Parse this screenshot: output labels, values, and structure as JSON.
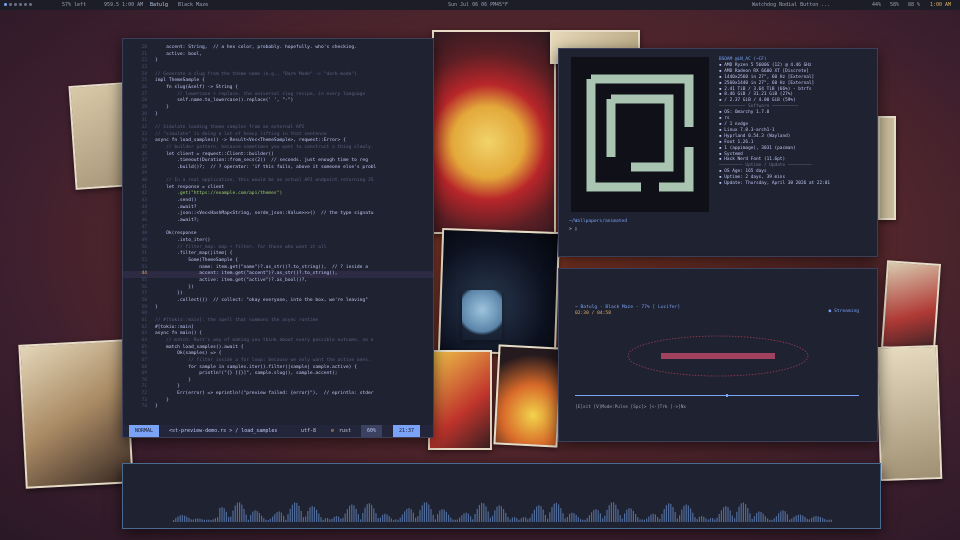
{
  "topbar": {
    "workspaces": "1 2 3 4 5 6",
    "battery": "57% left",
    "mem": "959.5 1:00 AM",
    "workspace_name": "Batulg",
    "track": "Black Maze",
    "datetime": "Sun Jul 06 06 PM",
    "temp": "45°F",
    "right_items": "Watchdog   Nodial Button   ...",
    "volume": "44%",
    "brightness": "58%",
    "battery_right": "88 %",
    "time_right": "1:00 AM"
  },
  "editor": {
    "lines": [
      {
        "n": "20",
        "t": "    accent: String,  // a hex color, probably. hopefully. who's checking.",
        "c": "fn"
      },
      {
        "n": "21",
        "t": "    active: bool,",
        "c": "fn"
      },
      {
        "n": "22",
        "t": "}",
        "c": "fn"
      },
      {
        "n": "23",
        "t": "",
        "c": ""
      },
      {
        "n": "24",
        "t": "// Generate a slug from the theme name (e.g., \"Dark Mode\" -> \"dark-mode\")",
        "c": "cmt"
      },
      {
        "n": "25",
        "t": "impl ThemeSample {",
        "c": "fn"
      },
      {
        "n": "26",
        "t": "    fn slug(&self) -> String {",
        "c": "fn"
      },
      {
        "n": "27",
        "t": "        // lowercase + replace. the universal slug recipe, in every language",
        "c": "cmt"
      },
      {
        "n": "28",
        "t": "        self.name.to_lowercase().replace(' ', \"-\")",
        "c": "fn"
      },
      {
        "n": "29",
        "t": "    }",
        "c": "fn"
      },
      {
        "n": "30",
        "t": "}",
        "c": "fn"
      },
      {
        "n": "31",
        "t": "",
        "c": ""
      },
      {
        "n": "32",
        "t": "// Simulate loading theme samples from an external API",
        "c": "cmt"
      },
      {
        "n": "33",
        "t": "// \"simulate\" is doing a lot of heavy lifting in that sentence",
        "c": "cmt"
      },
      {
        "n": "34",
        "t": "async fn load_samples() -> Result<Vec<ThemeSample>, reqwest::Error> {",
        "c": "fn"
      },
      {
        "n": "35",
        "t": "    // builder pattern, because sometimes you want to construct a thing slowly.",
        "c": "cmt"
      },
      {
        "n": "36",
        "t": "    let client = reqwest::Client::builder()",
        "c": "fn"
      },
      {
        "n": "37",
        "t": "        .timeout(Duration::from_secs(2))  // seconds. just enough time to reg",
        "c": "fn"
      },
      {
        "n": "38",
        "t": "        .build()?;  // ? operator: 'if this fails, above it someone else's probl",
        "c": "fn"
      },
      {
        "n": "39",
        "t": "",
        "c": ""
      },
      {
        "n": "40",
        "t": "    // In a real application, this would be an actual API endpoint returning JS",
        "c": "cmt"
      },
      {
        "n": "41",
        "t": "    let response = client",
        "c": "fn"
      },
      {
        "n": "42",
        "t": "        .get(\"https://example.com/api/themes\")",
        "c": "str"
      },
      {
        "n": "43",
        "t": "        .send()",
        "c": "fn"
      },
      {
        "n": "44",
        "t": "        .await?",
        "c": "fn"
      },
      {
        "n": "45",
        "t": "        .json::<Vec<HashMap<String, serde_json::Value>>>()  // the type signatu",
        "c": "fn"
      },
      {
        "n": "46",
        "t": "        .await?;",
        "c": "fn"
      },
      {
        "n": "47",
        "t": "",
        "c": ""
      },
      {
        "n": "48",
        "t": "    Ok(response",
        "c": "fn"
      },
      {
        "n": "49",
        "t": "        .into_iter()",
        "c": "fn"
      },
      {
        "n": "50",
        "t": "        // filter_map: map + filter, for those who want it all",
        "c": "cmt"
      },
      {
        "n": "51",
        "t": "        .filter_map(|item| {",
        "c": "fn"
      },
      {
        "n": "52",
        "t": "            Some(ThemeSample {",
        "c": "fn"
      },
      {
        "n": "53",
        "t": "                name: item.get(\"name\")?.as_str()?.to_string(),  // ? inside a",
        "c": "fn"
      },
      {
        "n": "44",
        "t": "                accent: item.get(\"accent\")?.as_str()?.to_string(),",
        "c": "fn",
        "cur": true
      },
      {
        "n": "55",
        "t": "                active: item.get(\"active\")?.as_bool()?,",
        "c": "fn"
      },
      {
        "n": "56",
        "t": "            })",
        "c": "fn"
      },
      {
        "n": "57",
        "t": "        })",
        "c": "fn"
      },
      {
        "n": "58",
        "t": "        .collect())  // collect: \"okay everyone, into the box, we're leaving\"",
        "c": "fn"
      },
      {
        "n": "59",
        "t": "}",
        "c": "fn"
      },
      {
        "n": "60",
        "t": "",
        "c": ""
      },
      {
        "n": "61",
        "t": "// #[tokio::main]: the spell that summons the async runtime",
        "c": "cmt"
      },
      {
        "n": "62",
        "t": "#[tokio::main]",
        "c": "fn"
      },
      {
        "n": "63",
        "t": "async fn main() {",
        "c": "fn"
      },
      {
        "n": "64",
        "t": "    // match: Rust's way of making you think about every possible outcome, no e",
        "c": "cmt"
      },
      {
        "n": "65",
        "t": "    match load_samples().await {",
        "c": "fn"
      },
      {
        "n": "66",
        "t": "        Ok(samples) => {",
        "c": "fn"
      },
      {
        "n": "67",
        "t": "            // filter inside a for loop: because we only want the active ones.",
        "c": "cmt"
      },
      {
        "n": "68",
        "t": "            for sample in samples.iter().filter(|sample| sample.active) {",
        "c": "fn"
      },
      {
        "n": "69",
        "t": "                println!(\"{} [{}]\", sample.slug(), sample.accent);",
        "c": "fn"
      },
      {
        "n": "70",
        "t": "            }",
        "c": "fn"
      },
      {
        "n": "71",
        "t": "        }",
        "c": "fn"
      },
      {
        "n": "72",
        "t": "        Err(error) => eprintln!(\"preview failed: {error}\"),  // eprintln: stder",
        "c": "fn"
      },
      {
        "n": "73",
        "t": "    }",
        "c": "fn"
      },
      {
        "n": "74",
        "t": "}",
        "c": "fn"
      }
    ],
    "status": {
      "mode": "NORMAL",
      "file": "<st-preview-demo.rs > / load_samples",
      "encoding": "utf-8",
      "lang": "rust",
      "percent": "60%",
      "position": "21:37"
    }
  },
  "fetch": {
    "user": "BSOAM @LN_AC (~CF)",
    "rows": [
      "AMD Ryzen 5 5600G (12) @ 4.46 GHz",
      "AMD Radeon RX 6600 XT [Discrete]",
      "1440x2560 in 27\", 60 Hz [External]",
      "2560x1440 in 27\", 60 Hz [External]",
      "2.41 TiB / 3.64 TiB (66%) - btrfs",
      "8.46 GiB / 31.21 GiB (27%)",
      "/ 2.37 GiB / 4.00 GiB (59%)"
    ],
    "software_label": "Software",
    "software": [
      "OS: Omarchy 1.7.0",
      "rs",
      "/ 1 nvdge",
      "Linux 7.0.3-arch1-1",
      "Hyprland 0.54.3 (Wayland)",
      "Foot 1.26.1",
      "1 (appimage), 3031 (pacman)",
      "Systemd",
      "Hack Nerd Font (11.6pt)"
    ],
    "uptime_label": "Uptime / Update",
    "uptime": [
      "OS Age: 165 days",
      "Uptime: 2 days, 39 mins",
      "Update: Thursday, April 30 2026 at 22:01"
    ],
    "prompt_path": "~/Wallpapers/animated",
    "prompt_symbol": ">"
  },
  "player": {
    "title": "~ Batulg - Black Maze - 77% [ Lucifer]",
    "time": "02:30 / 04:58",
    "streaming": "Streaming",
    "progress": 0.53,
    "keys": "[E]xit [V]Mode:Pulse [Spc]>  [<-]Trk  [->]Nx"
  }
}
